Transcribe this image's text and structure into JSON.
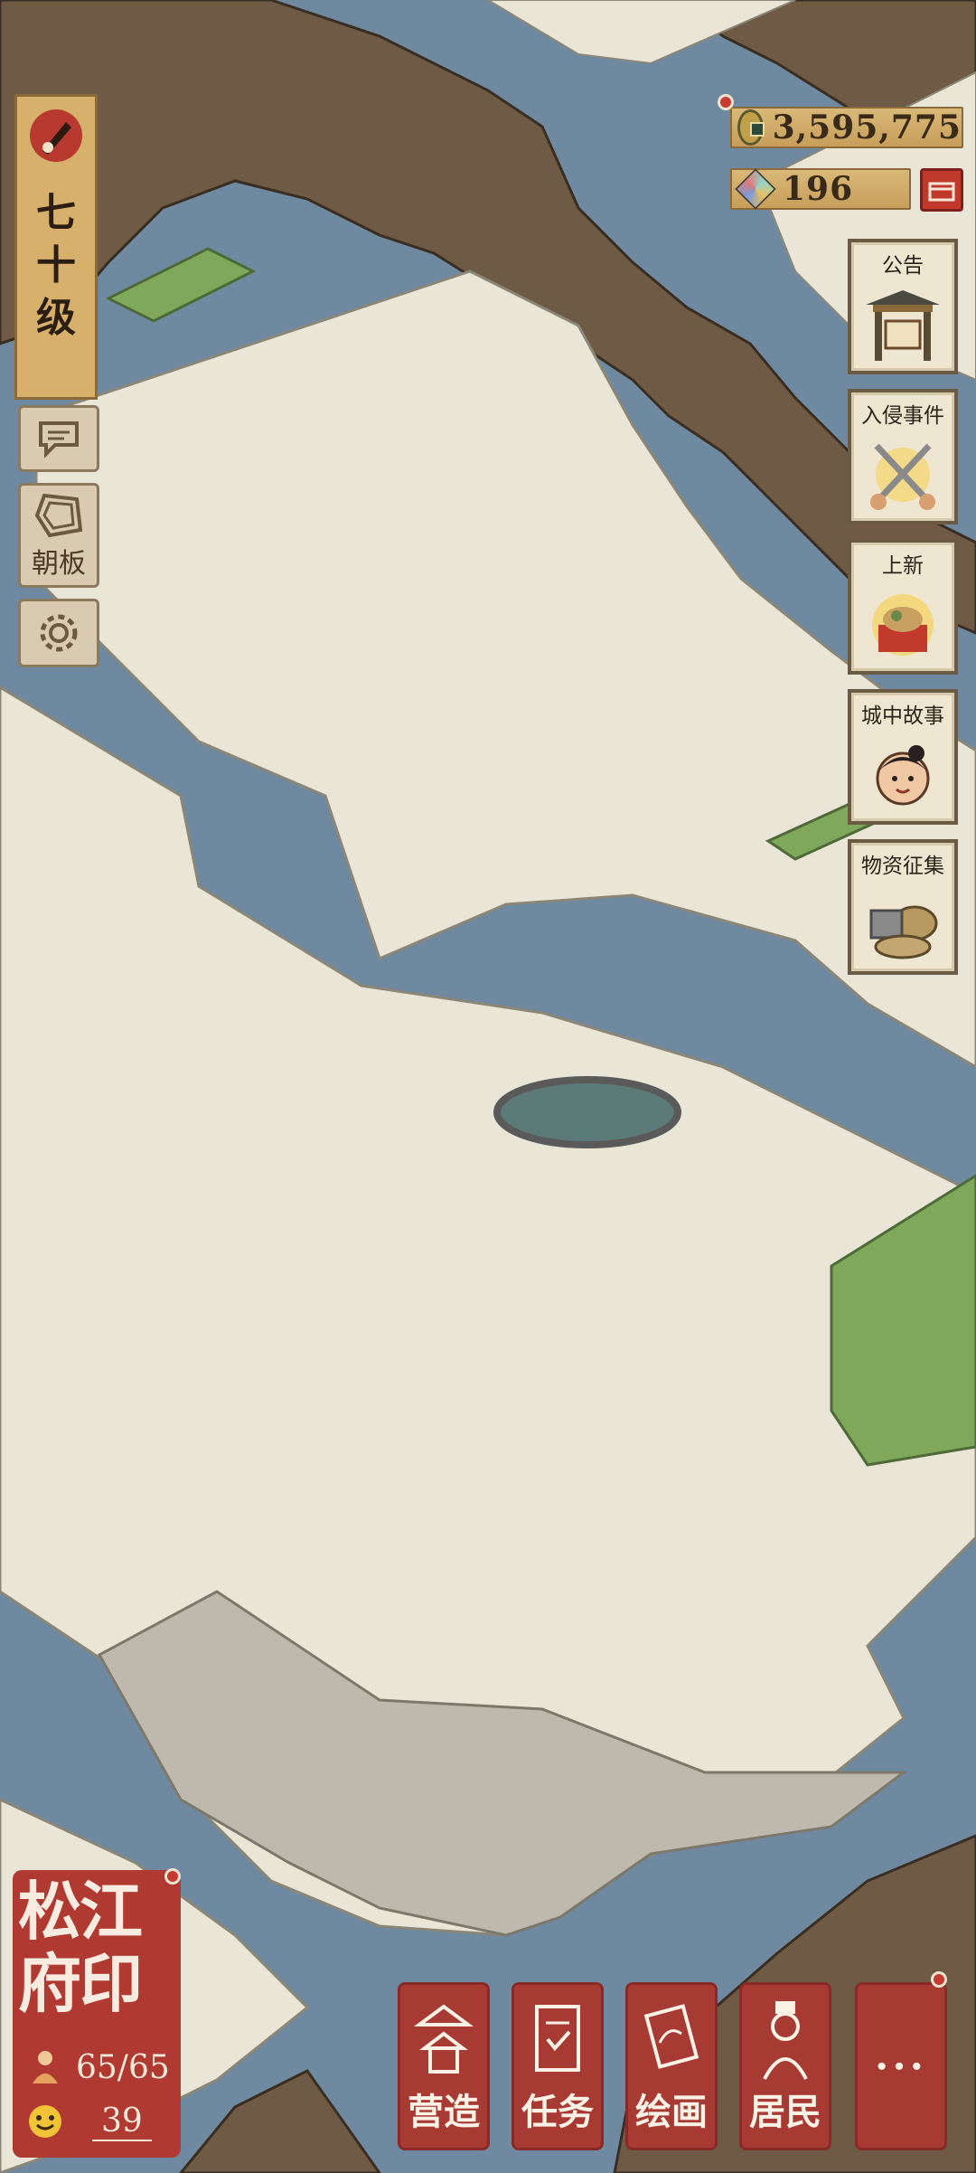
{
  "level": {
    "text": "七十级",
    "icon": "brush-seal-icon"
  },
  "currency": {
    "coins": {
      "value": "3,595,775",
      "icon": "copper-coin-icon"
    },
    "gems": {
      "value": "196",
      "icon": "jade-gem-icon"
    }
  },
  "left_menu": {
    "chat": {
      "icon": "chat-bubble-icon"
    },
    "board": {
      "label": "朝板",
      "icon": "board-icon"
    },
    "settings": {
      "icon": "gear-icon"
    }
  },
  "side_cards": [
    {
      "label": "公告",
      "icon": "notice-gate-icon"
    },
    {
      "label": "入侵事件",
      "icon": "crossed-swords-icon"
    },
    {
      "label": "上新",
      "icon": "new-goods-icon"
    },
    {
      "label": "城中故事",
      "icon": "child-portrait-icon"
    },
    {
      "label": "物资征集",
      "icon": "supply-baskets-icon"
    }
  ],
  "seal": {
    "title": "松江府印",
    "population": "65/65",
    "happiness": "39",
    "population_icon": "resident-icon",
    "happiness_icon": "smile-face-icon"
  },
  "bottom_bar": [
    {
      "label": "营造",
      "icon": "pavilion-icon"
    },
    {
      "label": "任务",
      "icon": "scroll-book-icon"
    },
    {
      "label": "绘画",
      "icon": "painting-scroll-icon"
    },
    {
      "label": "居民",
      "icon": "scholar-icon"
    },
    {
      "label": "···",
      "icon": "more-icon"
    }
  ],
  "colors": {
    "water": "#6f8aa0",
    "land": "#e9e6d8",
    "dirt": "#6e5a45",
    "grass": "#7fa85a",
    "seal_red": "#b03a32"
  }
}
